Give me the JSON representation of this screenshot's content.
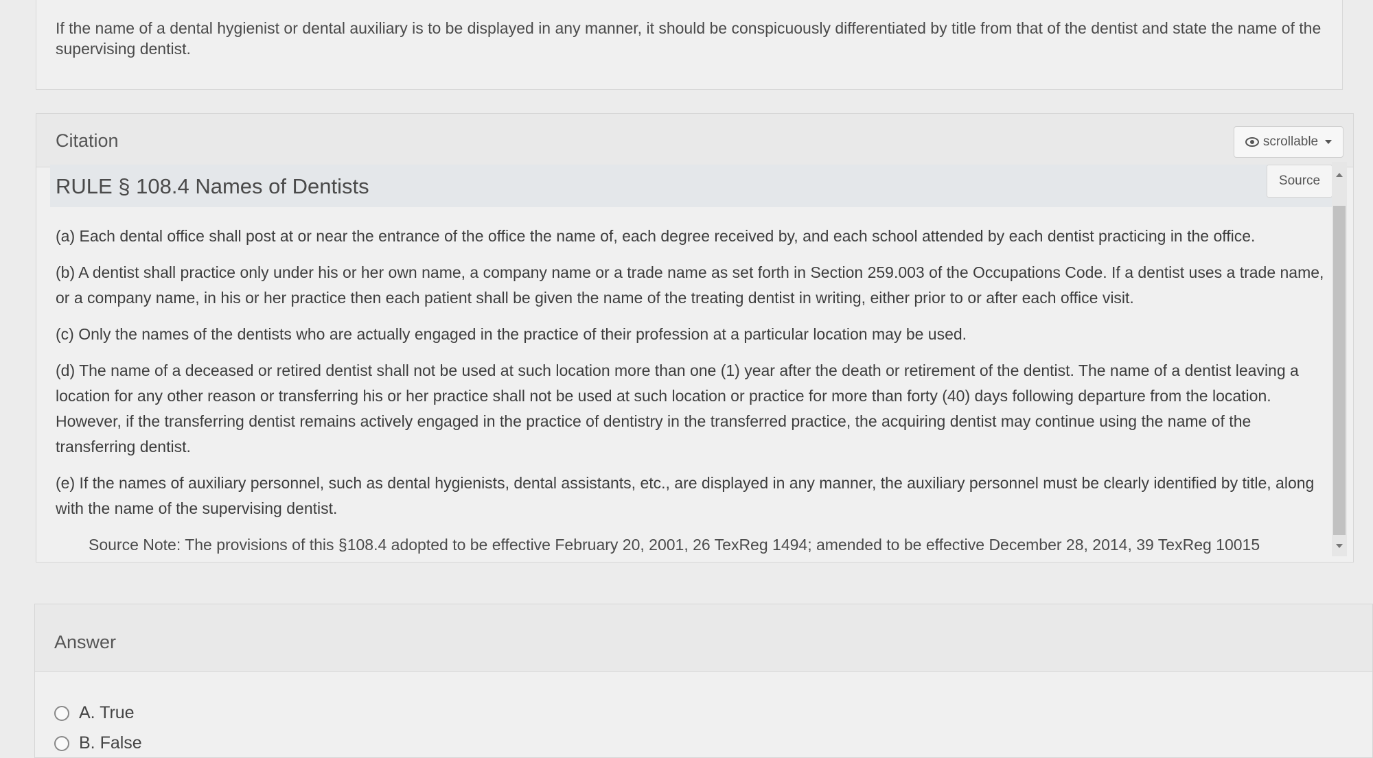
{
  "question": {
    "text": "If the name of a dental hygienist or dental auxiliary is to be displayed in any manner, it should be conspicuously differentiated by title from that of the dentist and state the name of the supervising dentist."
  },
  "citation": {
    "title": "Citation",
    "scrollable_label": "scrollable",
    "scrollable_icon": "eye-icon",
    "rule_title": "RULE § 108.4 Names of Dentists",
    "source_label": "Source",
    "paragraphs": [
      "(a) Each dental office shall post at or near the entrance of the office the name of, each degree received by, and each school attended by each dentist practicing in the office.",
      "(b) A dentist shall practice only under his or her own name, a company name or a trade name as set forth in Section 259.003 of the Occupations Code. If a dentist uses a trade name, or a company name, in his or her practice then each patient shall be given the name of the treating dentist in writing, either prior to or after each office visit.",
      "(c) Only the names of the dentists who are actually engaged in the practice of their profession at a particular location may be used.",
      "(d) The name of a deceased or retired dentist shall not be used at such location more than one (1) year after the death or retirement of the dentist. The name of a dentist leaving a location for any other reason or transferring his or her practice shall not be used at such location or practice for more than forty (40) days following departure from the location. However, if the transferring dentist remains actively engaged in the practice of dentistry in the transferred practice, the acquiring dentist may continue using the name of the transferring dentist.",
      "(e) If the names of auxiliary personnel, such as dental hygienists, dental assistants, etc., are displayed in any manner, the auxiliary personnel must be clearly identified by title, along with the name of the supervising dentist."
    ],
    "source_note": "Source Note: The provisions of this §108.4 adopted to be effective February 20, 2001, 26 TexReg 1494; amended to be effective December 28, 2014, 39 TexReg 10015"
  },
  "answer": {
    "title": "Answer",
    "options": [
      {
        "label": "A. True"
      },
      {
        "label": "B. False"
      }
    ]
  }
}
